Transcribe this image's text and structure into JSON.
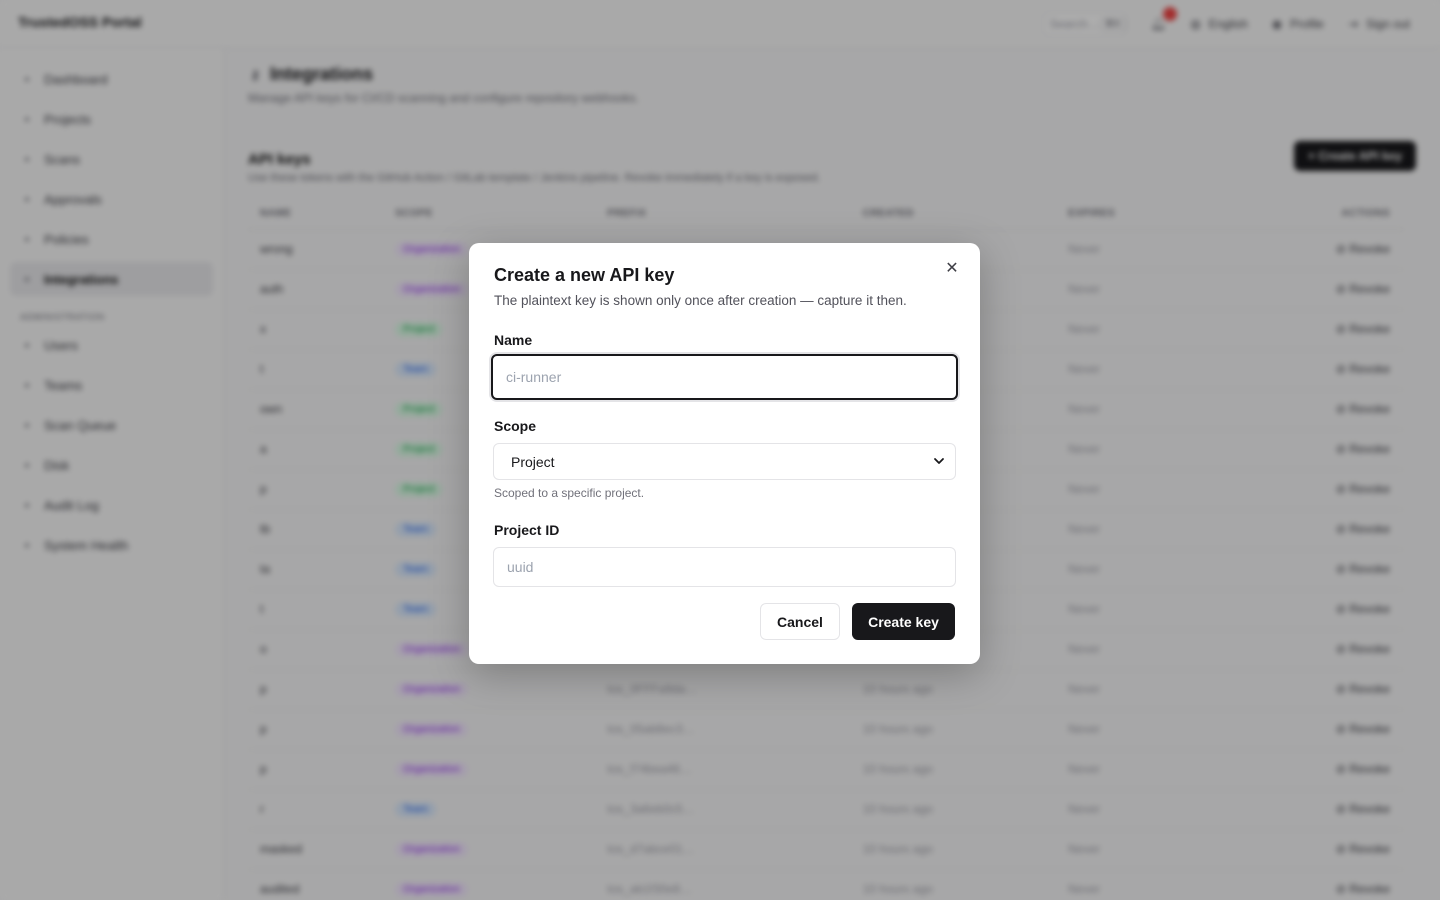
{
  "app": {
    "brand": "TrustedOSS Portal",
    "search_placeholder": "Search…",
    "search_shortcut": "⌘K",
    "language": "English",
    "profile": "Profile",
    "sign_out": "Sign out"
  },
  "sidebar": {
    "items": [
      {
        "label": "Dashboard",
        "icon": "grid-icon"
      },
      {
        "label": "Projects",
        "icon": "folder-icon"
      },
      {
        "label": "Scans",
        "icon": "scan-icon"
      },
      {
        "label": "Approvals",
        "icon": "clipboard-icon"
      },
      {
        "label": "Policies",
        "icon": "shield-icon"
      },
      {
        "label": "Integrations",
        "icon": "key-icon"
      }
    ],
    "admin_section": "Administration",
    "admin_items": [
      {
        "label": "Users",
        "icon": "user-icon"
      },
      {
        "label": "Teams",
        "icon": "users-icon"
      },
      {
        "label": "Scan Queue",
        "icon": "queue-icon"
      },
      {
        "label": "Disk",
        "icon": "disk-icon"
      },
      {
        "label": "Audit Log",
        "icon": "log-icon"
      },
      {
        "label": "System Health",
        "icon": "pulse-icon"
      }
    ]
  },
  "page": {
    "title": "Integrations",
    "subtitle": "Manage API keys for CI/CD scanning and configure repository webhooks.",
    "section_title": "API keys",
    "section_subtitle": "Use these tokens with the GitHub Action / GitLab template / Jenkins pipeline. Revoke immediately if a key is exposed.",
    "create_button": "Create API key"
  },
  "table": {
    "columns": [
      "NAME",
      "SCOPE",
      "PREFIX",
      "CREATED",
      "EXPIRES",
      "ACTIONS"
    ],
    "revoke_label": "Revoke",
    "rows": [
      {
        "name": "wrong",
        "scope": "Organization",
        "prefix": "",
        "created": "",
        "expires": "Never"
      },
      {
        "name": "auth",
        "scope": "Organization",
        "prefix": "",
        "created": "",
        "expires": "Never"
      },
      {
        "name": "x",
        "scope": "Project",
        "prefix": "",
        "created": "",
        "expires": "Never"
      },
      {
        "name": "t",
        "scope": "Team",
        "prefix": "",
        "created": "",
        "expires": "Never"
      },
      {
        "name": "own",
        "scope": "Project",
        "prefix": "",
        "created": "",
        "expires": "Never"
      },
      {
        "name": "a",
        "scope": "Project",
        "prefix": "",
        "created": "",
        "expires": "Never"
      },
      {
        "name": "p",
        "scope": "Project",
        "prefix": "",
        "created": "",
        "expires": "Never"
      },
      {
        "name": "tb",
        "scope": "Team",
        "prefix": "",
        "created": "",
        "expires": "Never"
      },
      {
        "name": "ta",
        "scope": "Team",
        "prefix": "",
        "created": "",
        "expires": "Never"
      },
      {
        "name": "t",
        "scope": "Team",
        "prefix": "",
        "created": "",
        "expires": "Never"
      },
      {
        "name": "o",
        "scope": "Organization",
        "prefix": "",
        "created": "",
        "expires": "Never"
      },
      {
        "name": "p",
        "scope": "Organization",
        "prefix": "tos_0FFFa9da…",
        "created": "10 hours ago",
        "expires": "Never"
      },
      {
        "name": "p",
        "scope": "Organization",
        "prefix": "tos_05ab8ec3…",
        "created": "10 hours ago",
        "expires": "Never"
      },
      {
        "name": "p",
        "scope": "Organization",
        "prefix": "tos_f74bea46…",
        "created": "10 hours ago",
        "expires": "Never"
      },
      {
        "name": "r",
        "scope": "Team",
        "prefix": "tos_3a6eb0c5…",
        "created": "10 hours ago",
        "expires": "Never"
      },
      {
        "name": "masked",
        "scope": "Organization",
        "prefix": "tos_d7abce01…",
        "created": "10 hours ago",
        "expires": "Never"
      },
      {
        "name": "audited",
        "scope": "Organization",
        "prefix": "tos_ab1f30e8…",
        "created": "10 hours ago",
        "expires": "Never"
      }
    ]
  },
  "modal": {
    "title": "Create a new API key",
    "description": "The plaintext key is shown only once after creation — capture it then.",
    "name_label": "Name",
    "name_placeholder": "ci-runner",
    "name_value": "",
    "scope_label": "Scope",
    "scope_value": "Project",
    "scope_hint": "Scoped to a specific project.",
    "project_label": "Project ID",
    "project_placeholder": "uuid",
    "project_value": "",
    "cancel": "Cancel",
    "create": "Create key"
  },
  "colors": {
    "primary": "#18181b",
    "organization_badge": "#9333ea",
    "project_badge": "#16a34a",
    "team_badge": "#2563eb",
    "notification": "#ef4444"
  }
}
